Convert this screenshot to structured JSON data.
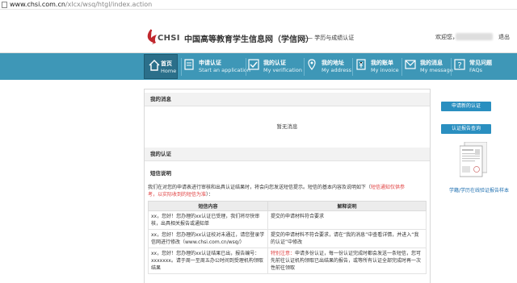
{
  "browser": {
    "url_host": "www.chsi.com.cn",
    "url_path": "/xlcx/wsq/htgl/index.action"
  },
  "header": {
    "logo_text": "CHSI",
    "site_title": "中国高等教育学生信息网（学信网）",
    "site_subtitle": "—— 学历与成绩认证",
    "welcome": "欢迎您，",
    "logout": "退出"
  },
  "nav": {
    "items": [
      {
        "zh": "首页",
        "en": "Home",
        "icon": "home-icon"
      },
      {
        "zh": "申请认证",
        "en": "Start an application",
        "icon": "apply-icon"
      },
      {
        "zh": "我的认证",
        "en": "My verification",
        "icon": "verification-icon"
      },
      {
        "zh": "我的地址",
        "en": "My address",
        "icon": "address-icon"
      },
      {
        "zh": "我的账单",
        "en": "My invoice",
        "icon": "invoice-icon"
      },
      {
        "zh": "我的消息",
        "en": "My message",
        "icon": "message-icon"
      },
      {
        "zh": "常见问题",
        "en": "FAQs",
        "icon": "faq-icon"
      }
    ],
    "active_index": 0
  },
  "main": {
    "messages_title": "我的消息",
    "no_messages": "暂无消息",
    "cert_title": "我的认证",
    "sms_title": "短信说明",
    "note_text": "我们在对您的申请表进行审核和出具认证结果时，将会向您发送短信提示。短信的基本内容及说明如下（",
    "note_red_1": "短信通知仅供参",
    "note_red_2": "考，以实际收到的短信为准",
    "note_tail": "）：",
    "table": {
      "headers": [
        "短信内容",
        "解释说明"
      ],
      "rows": [
        {
          "content": "xx，您好！您办理的xx认证已受理，我们将尽快审核，出具相关报告或通知单",
          "explanation": "提交的申请材料符合要求"
        },
        {
          "content": "xx，您好！您办理的xx认证校对未通过，请您登录学信网进行修改（www.chsi.com.cn/wsq/）",
          "explanation": "提交的申请材料不符合要求，请在“我的消息”中查看详情，并进入“我的认证”中修改"
        },
        {
          "content": "xx，您好！您办理的xx认证结果已出，报告编号：xxxxxxx。请于周一至周五办公时间到受理机构领取结果",
          "explanation_red": "特别注意：",
          "explanation": "申请多份认证，每一份认证完成时都会发送一条短信，您可先前往认证机构领取已出结果的报告，或等所有认证全部完成时再一次性前往领取"
        }
      ]
    }
  },
  "sidebar": {
    "btn_apply": "申请新的认证",
    "btn_query": "认证报告查询",
    "doc_link": "学籍/学历在线验证报告样本"
  },
  "colors": {
    "nav_bg": "#3e97b7",
    "nav_active": "#2b6f8a",
    "button_blue": "#2a8fc0",
    "note_red": "#e04040"
  }
}
